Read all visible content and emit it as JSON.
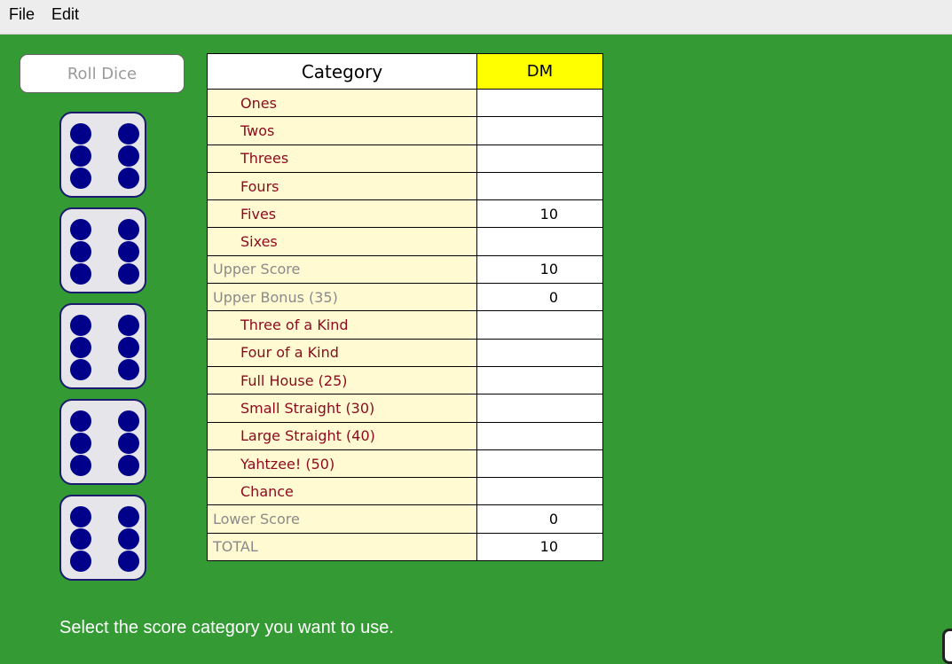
{
  "menu": {
    "file": "File",
    "edit": "Edit"
  },
  "roll_button": "Roll Dice",
  "dice": [
    6,
    6,
    6,
    6,
    6
  ],
  "scorecard": {
    "category_header": "Category",
    "player_header": "DM",
    "rows": [
      {
        "label": "Ones",
        "value": "",
        "kind": "category"
      },
      {
        "label": "Twos",
        "value": "",
        "kind": "category"
      },
      {
        "label": "Threes",
        "value": "",
        "kind": "category"
      },
      {
        "label": "Fours",
        "value": "",
        "kind": "category"
      },
      {
        "label": "Fives",
        "value": "10",
        "kind": "category"
      },
      {
        "label": "Sixes",
        "value": "",
        "kind": "category"
      },
      {
        "label": "Upper Score",
        "value": "10",
        "kind": "total"
      },
      {
        "label": "Upper Bonus (35)",
        "value": "0",
        "kind": "total"
      },
      {
        "label": "Three of a Kind",
        "value": "",
        "kind": "category"
      },
      {
        "label": "Four of a Kind",
        "value": "",
        "kind": "category"
      },
      {
        "label": "Full House (25)",
        "value": "",
        "kind": "category"
      },
      {
        "label": "Small Straight (30)",
        "value": "",
        "kind": "category"
      },
      {
        "label": "Large Straight (40)",
        "value": "",
        "kind": "category"
      },
      {
        "label": "Yahtzee! (50)",
        "value": "",
        "kind": "category"
      },
      {
        "label": "Chance",
        "value": "",
        "kind": "category"
      },
      {
        "label": "Lower Score",
        "value": "0",
        "kind": "total"
      },
      {
        "label": "TOTAL",
        "value": "10",
        "kind": "total"
      }
    ]
  },
  "status": "Select the score category you want to use.",
  "colors": {
    "table_bg": "#349a34",
    "category_text": "#8b0a1e",
    "category_bg": "#fffad1",
    "player_header_bg": "#ffff00",
    "pip": "#00008b"
  }
}
